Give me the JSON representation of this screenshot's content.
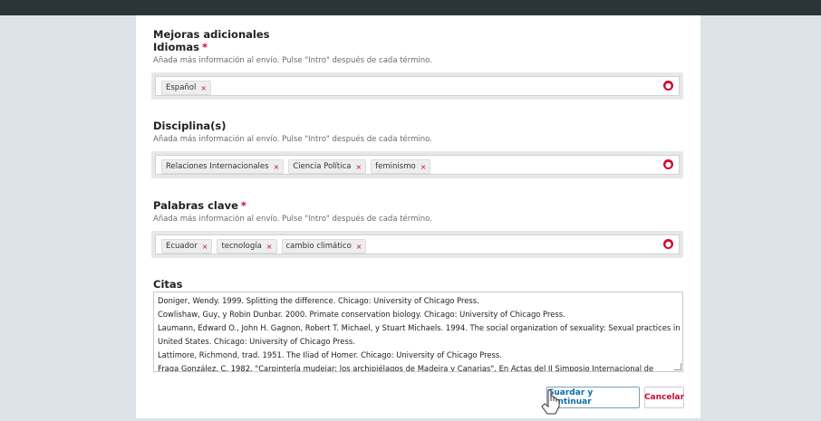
{
  "form": {
    "additional_title": "Mejoras adicionales",
    "required_marker": "*",
    "help_text": "Añada más información al envío. Pulse \"Intro\" después de cada término.",
    "idiomas": {
      "label": "Idiomas",
      "tags": [
        "Español"
      ]
    },
    "disciplinas": {
      "label": "Disciplina(s)",
      "tags": [
        "Relaciones Internacionales",
        "Ciencia Política",
        "feminismo"
      ]
    },
    "palabras": {
      "label": "Palabras clave",
      "tags": [
        "Ecuador",
        "tecnología",
        "cambio climático"
      ]
    },
    "citas": {
      "label": "Citas",
      "lines": [
        "Doniger, Wendy. 1999. Splitting the difference. Chicago: University of Chicago Press.",
        "Cowlishaw, Guy, y Robin Dunbar. 2000. Primate conservation biology. Chicago: University of Chicago Press.",
        "Laumann, Edward O., John H. Gagnon, Robert T. Michael, y Stuart Michaels. 1994. The social organization of sexuality: Sexual practices in the",
        "United States. Chicago: University of Chicago Press.",
        "Lattimore, Richmond, trad. 1951. The Iliad of Homer. Chicago: University of Chicago Press.",
        "Fraga González, C. 1982. \"Carpintería mudejar: los archipiélagos de Madeira y Canarias\". En Actas del II Simposio Internacional de"
      ]
    },
    "remove_glyph": "×",
    "save_label": "Guardar y continuar",
    "cancel_label": "Cancelar"
  },
  "colors": {
    "required": "#d00a2e",
    "link_blue": "#0a6ea8",
    "topbar": "#2a3439"
  },
  "icons": {
    "tag_remove": "close-icon",
    "field_language": "globe-icon",
    "cursor": "pointer-cursor-icon"
  }
}
